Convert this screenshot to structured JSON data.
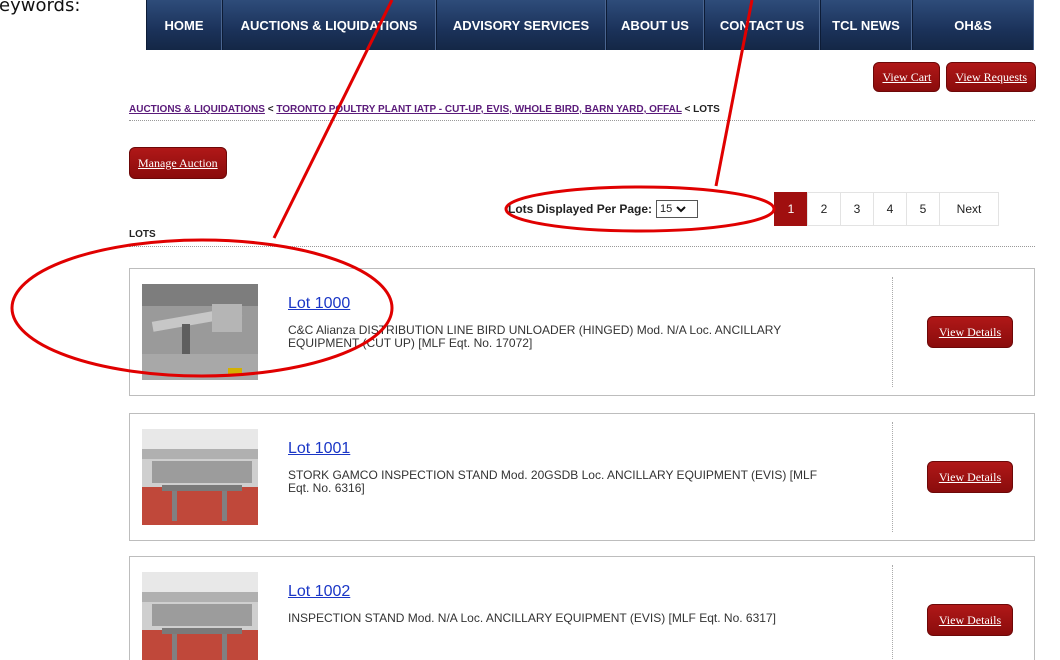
{
  "fragment_text": "eywords:",
  "nav": {
    "items": [
      {
        "label": "HOME"
      },
      {
        "label": "AUCTIONS & LIQUIDATIONS"
      },
      {
        "label": "ADVISORY SERVICES"
      },
      {
        "label": "ABOUT US"
      },
      {
        "label": "CONTACT US"
      },
      {
        "label": "TCL NEWS"
      },
      {
        "label": "OH&S"
      }
    ]
  },
  "cart": {
    "view_cart_label": "View Cart",
    "view_requests_label": "View Requests"
  },
  "breadcrumb": {
    "auctions_label": "AUCTIONS & LIQUIDATIONS",
    "separator": "<",
    "plant_label": "TORONTO POULTRY PLANT IATP - CUT-UP, EVIS, WHOLE BIRD, BARN YARD, OFFAL",
    "current_label": "LOTS"
  },
  "manage_auction_label": "Manage Auction",
  "pagination": {
    "per_page_label": "Lots Displayed Per Page:",
    "per_page_value": "15",
    "pages": [
      "1",
      "2",
      "3",
      "4",
      "5"
    ],
    "active_page": "1",
    "next_label": "Next"
  },
  "lots_heading": "LOTS",
  "lots": [
    {
      "title": "Lot 1000",
      "description": "C&C Alianza DISTRIBUTION LINE BIRD UNLOADER (HINGED) Mod. N/A Loc. ANCILLARY EQUIPMENT (CUT UP) [MLF Eqt. No. 17072]",
      "button_label": "View Details"
    },
    {
      "title": "Lot 1001",
      "description": "STORK GAMCO INSPECTION STAND Mod. 20GSDB Loc. ANCILLARY EQUIPMENT (EVIS) [MLF Eqt. No. 6316]",
      "button_label": "View Details"
    },
    {
      "title": "Lot 1002",
      "description": "INSPECTION STAND Mod. N/A Loc. ANCILLARY EQUIPMENT (EVIS) [MLF Eqt. No. 6317]",
      "button_label": "View Details"
    }
  ],
  "colors": {
    "nav_bg": "#1b325a",
    "button_red": "#a00f0f",
    "link_blue": "#1a36c6",
    "breadcrumb_link": "#5a1a7a",
    "annotation_red": "#e00000"
  }
}
